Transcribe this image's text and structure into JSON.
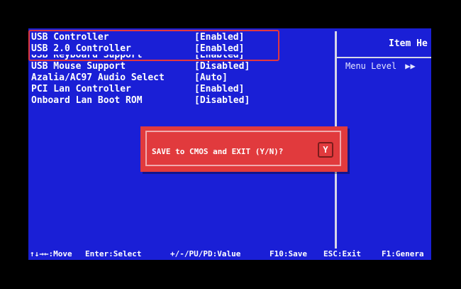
{
  "settings": [
    {
      "name": "USB Controller",
      "value": "[Enabled]"
    },
    {
      "name": "USB 2.0 Controller",
      "value": "[Enabled]"
    },
    {
      "name": "USB Keyboard Support",
      "value": "[Enabled]"
    },
    {
      "name": "USB Mouse Support",
      "value": "[Disabled]"
    },
    {
      "name": "Azalia/AC97 Audio Select",
      "value": "[Auto]"
    },
    {
      "name": "PCI Lan Controller",
      "value": "[Enabled]"
    },
    {
      "name": "Onboard Lan Boot ROM",
      "value": "[Disabled]"
    }
  ],
  "help": {
    "title": "Item He",
    "menu_level": "Menu Level",
    "menu_level_marker": "▶▶"
  },
  "dialog": {
    "prompt": "SAVE to CMOS and EXIT (Y/N)?",
    "answer": "Y"
  },
  "footer": {
    "move": "↑↓→←:Move",
    "select": "Enter:Select",
    "value": "+/-/PU/PD:Value",
    "save": "F10:Save",
    "exit": "ESC:Exit",
    "general": "F1:Genera"
  },
  "colors": {
    "bios_background": "#1a1fd6",
    "dialog_background": "#e13a3d",
    "highlight": "#e3373f"
  }
}
